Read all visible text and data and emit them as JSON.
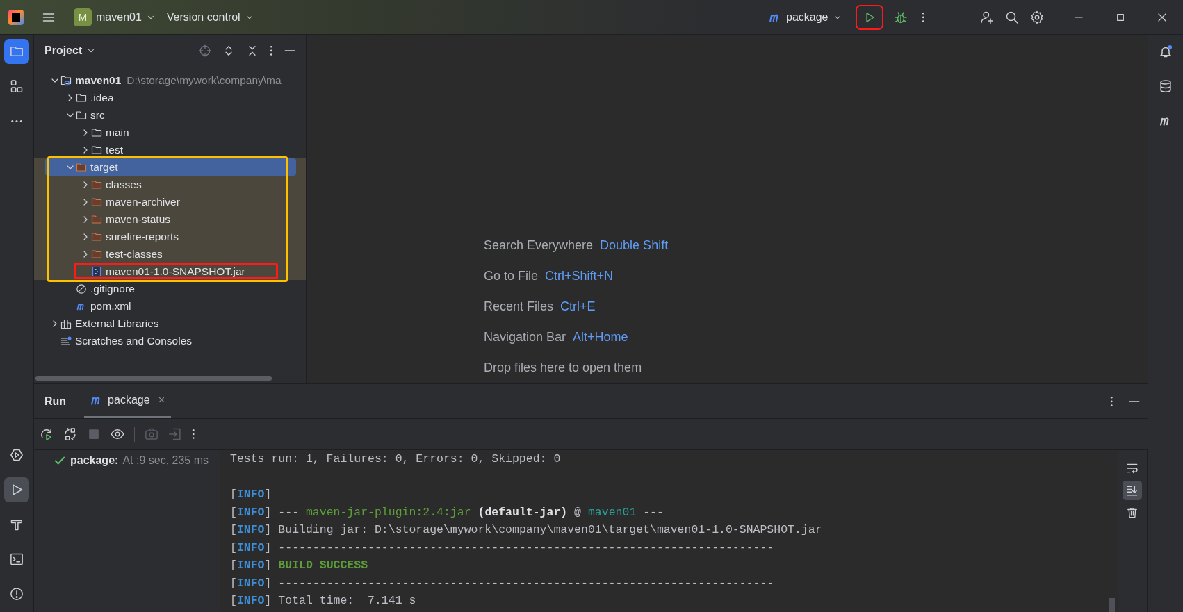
{
  "title_bar": {
    "project": {
      "badge": "M",
      "name": "maven01"
    },
    "vcs": "Version control",
    "run_config": "package",
    "run_button": {
      "highlighted": true
    }
  },
  "left_toolbar": {
    "top": [
      {
        "kind": "project",
        "selected": true
      },
      {
        "kind": "structure",
        "selected": false
      },
      {
        "kind": "more",
        "selected": false
      }
    ],
    "bottom": [
      {
        "kind": "services",
        "selected": false
      },
      {
        "kind": "run",
        "selected": true
      },
      {
        "kind": "build",
        "selected": false
      },
      {
        "kind": "terminal",
        "selected": false
      },
      {
        "kind": "problems",
        "selected": false
      }
    ]
  },
  "project_panel": {
    "title": "Project",
    "tree": [
      {
        "label": "maven01",
        "path": "D:\\storage\\mywork\\company\\ma",
        "kind": "module",
        "expanded": true,
        "selected": false,
        "children": [
          {
            "label": ".idea",
            "kind": "folder",
            "expanded": false,
            "selected": false
          },
          {
            "label": "src",
            "kind": "folder",
            "expanded": true,
            "selected": false,
            "children": [
              {
                "label": "main",
                "kind": "folder",
                "expanded": false,
                "selected": false
              },
              {
                "label": "test",
                "kind": "folder",
                "expanded": false,
                "selected": false
              }
            ]
          },
          {
            "label": "target",
            "kind": "folder",
            "expanded": true,
            "selected": true,
            "excluded": true,
            "highlighted": true,
            "children": [
              {
                "label": "classes",
                "kind": "folder",
                "expanded": false,
                "selected": false
              },
              {
                "label": "maven-archiver",
                "kind": "folder",
                "expanded": false,
                "selected": false
              },
              {
                "label": "maven-status",
                "kind": "folder",
                "expanded": false,
                "selected": false
              },
              {
                "label": "surefire-reports",
                "kind": "folder",
                "expanded": false,
                "selected": false
              },
              {
                "label": "test-classes",
                "kind": "folder",
                "expanded": false,
                "selected": false
              },
              {
                "label": "maven01-1.0-SNAPSHOT.jar",
                "kind": "jar",
                "selected": false,
                "highlighted": true
              }
            ]
          },
          {
            "label": ".gitignore",
            "kind": "ignore",
            "selected": false
          },
          {
            "label": "pom.xml",
            "kind": "maven",
            "selected": false
          }
        ]
      },
      {
        "label": "External Libraries",
        "kind": "libraries",
        "expanded": false,
        "selected": false
      },
      {
        "label": "Scratches and Consoles",
        "kind": "scratches",
        "selected": false
      }
    ]
  },
  "editor": {
    "hints": [
      {
        "label": "Search Everywhere",
        "shortcut": "Double Shift"
      },
      {
        "label": "Go to File",
        "shortcut": "Ctrl+Shift+N"
      },
      {
        "label": "Recent Files",
        "shortcut": "Ctrl+E"
      },
      {
        "label": "Navigation Bar",
        "shortcut": "Alt+Home"
      },
      {
        "label": "Drop files here to open them"
      }
    ]
  },
  "run_panel": {
    "title": "Run",
    "tabs": [
      {
        "label": "package",
        "selected": true,
        "close": "×"
      }
    ],
    "tree": [
      {
        "label": "package:",
        "detail": "At :9 sec, 235 ms",
        "kind": "success"
      }
    ],
    "console": [
      {
        "kind": "text",
        "segments": [
          {
            "kind": "text",
            "text": "Tests run: 1, Failures: 0, Errors: 0, Skipped: 0"
          }
        ]
      },
      {
        "kind": "blank"
      },
      {
        "kind": "text",
        "segments": [
          {
            "kind": "bracket",
            "text": "["
          },
          {
            "kind": "level",
            "text": "INFO"
          },
          {
            "kind": "bracket",
            "text": "]"
          }
        ]
      },
      {
        "kind": "text",
        "segments": [
          {
            "kind": "bracket",
            "text": "["
          },
          {
            "kind": "level",
            "text": "INFO"
          },
          {
            "kind": "bracket",
            "text": "]"
          },
          {
            "kind": "text",
            "text": " --- "
          },
          {
            "kind": "plugin",
            "text": "maven-jar-plugin:2.4:jar"
          },
          {
            "kind": "bold",
            "text": " (default-jar)"
          },
          {
            "kind": "text",
            "text": " @ "
          },
          {
            "kind": "module",
            "text": "maven01"
          },
          {
            "kind": "text",
            "text": " ---"
          }
        ]
      },
      {
        "kind": "text",
        "segments": [
          {
            "kind": "bracket",
            "text": "["
          },
          {
            "kind": "level",
            "text": "INFO"
          },
          {
            "kind": "bracket",
            "text": "]"
          },
          {
            "kind": "text",
            "text": " Building jar: D:\\storage\\mywork\\company\\maven01\\target\\maven01-1.0-SNAPSHOT.jar"
          }
        ]
      },
      {
        "kind": "text",
        "segments": [
          {
            "kind": "bracket",
            "text": "["
          },
          {
            "kind": "level",
            "text": "INFO"
          },
          {
            "kind": "bracket",
            "text": "]"
          },
          {
            "kind": "text",
            "text": " ------------------------------------------------------------------------"
          }
        ]
      },
      {
        "kind": "text",
        "segments": [
          {
            "kind": "bracket",
            "text": "["
          },
          {
            "kind": "level",
            "text": "INFO"
          },
          {
            "kind": "bracket",
            "text": "]"
          },
          {
            "kind": "success",
            "text": " BUILD SUCCESS"
          }
        ]
      },
      {
        "kind": "text",
        "segments": [
          {
            "kind": "bracket",
            "text": "["
          },
          {
            "kind": "level",
            "text": "INFO"
          },
          {
            "kind": "bracket",
            "text": "]"
          },
          {
            "kind": "text",
            "text": " ------------------------------------------------------------------------"
          }
        ]
      },
      {
        "kind": "text",
        "segments": [
          {
            "kind": "bracket",
            "text": "["
          },
          {
            "kind": "level",
            "text": "INFO"
          },
          {
            "kind": "bracket",
            "text": "]"
          },
          {
            "kind": "text",
            "text": " Total time:  7.141 s"
          }
        ]
      }
    ],
    "console_tools": [
      {
        "kind": "wrap",
        "selected": false
      },
      {
        "kind": "scroll-end",
        "selected": true
      },
      {
        "kind": "clear",
        "selected": false
      }
    ]
  },
  "right_toolbar": [
    {
      "kind": "notifications",
      "unread": true
    },
    {
      "kind": "database"
    },
    {
      "kind": "maven"
    }
  ]
}
